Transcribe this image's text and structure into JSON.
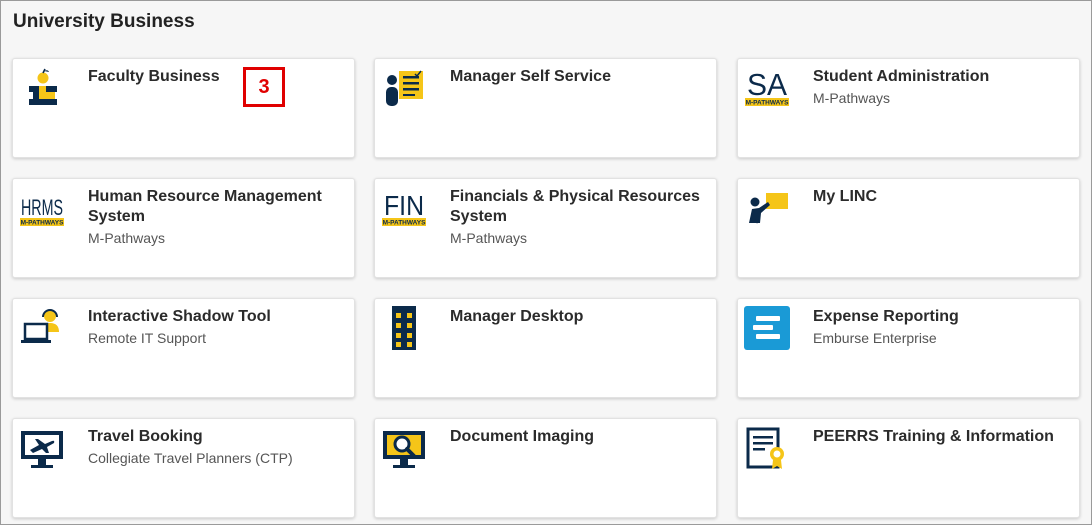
{
  "section": {
    "title": "University Business"
  },
  "marker": {
    "label": "3"
  },
  "colors": {
    "navy": "#0b2a4a",
    "maize": "#f5c518",
    "accent_red": "#e00000",
    "expense_blue": "#1a9ad6"
  },
  "tiles": [
    {
      "icon": "faculty-book-apple-icon",
      "title": "Faculty Business",
      "subtitle": ""
    },
    {
      "icon": "manager-checklist-icon",
      "title": "Manager Self Service",
      "subtitle": ""
    },
    {
      "icon": "sa-mpathways-logo",
      "title": "Student Administration",
      "subtitle": "M-Pathways",
      "logo_text": "SA",
      "logo_band": "M-PATHWAYS"
    },
    {
      "icon": "hrms-mpathways-logo",
      "title": "Human Resource Management System",
      "subtitle": "M-Pathways",
      "logo_text": "HRMS",
      "logo_band": "M-PATHWAYS"
    },
    {
      "icon": "fin-mpathways-logo",
      "title": "Financials & Physical Resources System",
      "subtitle": "M-Pathways",
      "logo_text": "FIN",
      "logo_band": "M-PATHWAYS"
    },
    {
      "icon": "presenter-board-icon",
      "title": "My LINC",
      "subtitle": ""
    },
    {
      "icon": "support-laptop-headset-icon",
      "title": "Interactive Shadow Tool",
      "subtitle": "Remote IT Support"
    },
    {
      "icon": "building-icon",
      "title": "Manager Desktop",
      "subtitle": ""
    },
    {
      "icon": "expense-e-logo-icon",
      "title": "Expense Reporting",
      "subtitle": "Emburse Enterprise"
    },
    {
      "icon": "monitor-airplane-icon",
      "title": "Travel Booking",
      "subtitle": "Collegiate Travel Planners (CTP)"
    },
    {
      "icon": "monitor-magnifier-icon",
      "title": "Document Imaging",
      "subtitle": ""
    },
    {
      "icon": "certificate-icon",
      "title": "PEERRS Training & Information",
      "subtitle": ""
    }
  ]
}
